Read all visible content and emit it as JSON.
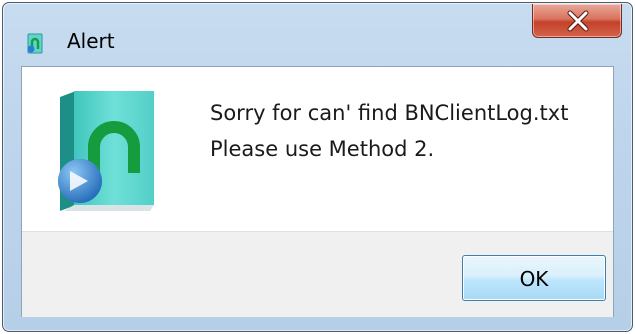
{
  "window": {
    "title": "Alert",
    "title_icon": "app-logo-icon",
    "close_icon": "close-icon"
  },
  "message": {
    "line1": "Sorry for can' find BNClientLog.txt",
    "line2": "Please use Method 2.",
    "icon": "book-app-icon"
  },
  "buttons": {
    "ok_label": "OK"
  },
  "colors": {
    "titlebar": "#bed5ec",
    "close_button": "#c4412a",
    "button_area": "#f0f0f0",
    "ok_border": "#3c7fb1",
    "icon_teal": "#4fd0c8",
    "icon_green": "#1fa84a",
    "icon_arrow": "#2a7fd0"
  }
}
